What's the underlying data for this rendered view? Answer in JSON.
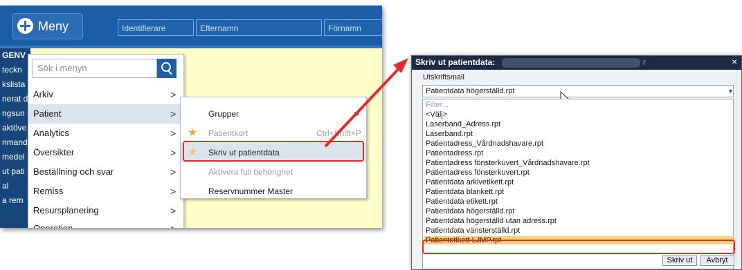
{
  "app": {
    "menu_button_label": "Meny",
    "fields": {
      "identifier_placeholder": "Identifierare",
      "lastname_placeholder": "Efternamn",
      "firstname_placeholder": "Förnamn"
    },
    "left_nav": [
      "GENV",
      "teckn",
      "kslista",
      "nerat d",
      "ngsun",
      "aktöve",
      "nmand",
      "medel",
      "ut pati",
      "al",
      "a rem"
    ],
    "search": {
      "placeholder": "Sök i menyn"
    },
    "menu_items": [
      {
        "label": "Arkiv",
        "chevron": ">"
      },
      {
        "label": "Patient",
        "chevron": ">"
      },
      {
        "label": "Analytics",
        "chevron": ">"
      },
      {
        "label": "Översikter",
        "chevron": ">"
      },
      {
        "label": "Beställning och svar",
        "chevron": ">"
      },
      {
        "label": "Remiss",
        "chevron": ">"
      },
      {
        "label": "Resursplanering",
        "chevron": ">"
      },
      {
        "label": "Operation",
        "chevron": ">"
      }
    ],
    "submenu_items": [
      {
        "label": "Grupper",
        "chevron": ">",
        "shortcut": ""
      },
      {
        "label": "Patientkort",
        "shortcut": "Ctrl+Shift+P"
      },
      {
        "label": "Skriv ut patientdata",
        "shortcut": ""
      },
      {
        "label": "Aktivera full behörighet",
        "shortcut": ""
      },
      {
        "label": "Reservnummer Master",
        "shortcut": ""
      }
    ],
    "icons": {
      "star": "star-icon",
      "search": "search-icon",
      "plus": "plus-icon"
    },
    "colors": {
      "topbar": "#1a5ea8",
      "highlight": "#e42b2b",
      "selected_option": "#f6d27a"
    }
  },
  "dialog": {
    "title": "Skriv ut patientdata:",
    "title_suffix": "r",
    "close": "×",
    "section_label": "Utskriftsmall",
    "selected_value": "Patientdata högerställd.rpt",
    "filter_placeholder": "Filter...",
    "options": [
      "<Välj>",
      "Laserband_Adress.rpt",
      "Laserband.rpt",
      "Patientadress_Vårdnadshavare.rpt",
      "Patientadress.rpt",
      "Patientadress fönsterkuvert_Vårdnadshavare.rpt",
      "Patientadress fönsterkuvert.rpt",
      "Patientdata arkivetikett.rpt",
      "Patientdata blankett.rpt",
      "Patientdata etikett.rpt",
      "Patientdata högerställd.rpt",
      "Patientdata högerställd utan adress.rpt",
      "Patientdata vänsterställd.rpt",
      "Patientetikett LJMP.rpt"
    ],
    "buttons": {
      "print": "Skriv ut",
      "cancel": "Avbryt"
    }
  }
}
